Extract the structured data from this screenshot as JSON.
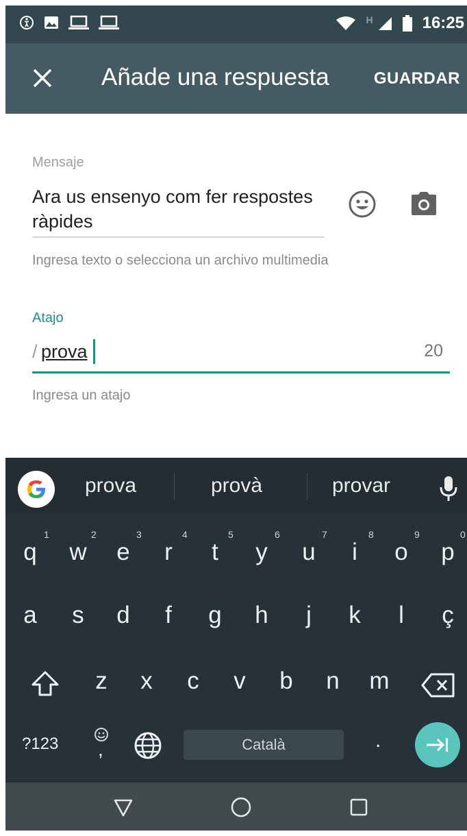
{
  "status_bar": {
    "time": "16:25",
    "network_letter": "H",
    "icons": [
      "accessibility-icon",
      "image-icon",
      "laptop-icon",
      "laptop-icon",
      "wifi-icon",
      "signal-icon",
      "battery-icon"
    ]
  },
  "app_bar": {
    "title": "Añade una respuesta",
    "save_label": "GUARDAR",
    "close_icon": "close-icon",
    "background": "#455b64"
  },
  "message_field": {
    "label": "Mensaje",
    "value": "Ara us ensenyo com fer respostes ràpides",
    "helper": "Ingresa texto o selecciona un archivo multimedia",
    "emoji_icon": "emoji-icon",
    "camera_icon": "camera-icon"
  },
  "shortcut_field": {
    "label": "Atajo",
    "prefix": "/",
    "value": "prova",
    "counter": "20",
    "helper": "Ingresa un atajo",
    "accent": "#1e8f83"
  },
  "keyboard": {
    "suggestions": [
      "prova",
      "provà",
      "provar"
    ],
    "row1": [
      "q",
      "w",
      "e",
      "r",
      "t",
      "y",
      "u",
      "i",
      "o",
      "p"
    ],
    "row1_hints": [
      "1",
      "2",
      "3",
      "4",
      "5",
      "6",
      "7",
      "8",
      "9",
      "0"
    ],
    "row2": [
      "a",
      "s",
      "d",
      "f",
      "g",
      "h",
      "j",
      "k",
      "l",
      "ç"
    ],
    "row3": [
      "z",
      "x",
      "c",
      "v",
      "b",
      "n",
      "m"
    ],
    "symbols_label": "?123",
    "comma": ",",
    "period": ".",
    "space_label": "Català",
    "enter_color": "#5ac5bd"
  },
  "nav_bar": {
    "buttons": [
      "back-icon",
      "home-icon",
      "recents-icon"
    ]
  }
}
